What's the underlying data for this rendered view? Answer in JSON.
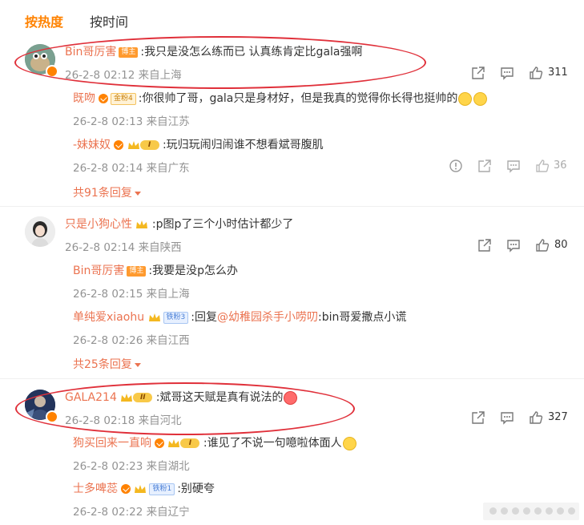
{
  "tabs": {
    "hot": "按热度",
    "time": "按时间"
  },
  "comments": [
    {
      "name": "Bin哥厉害",
      "badge": "博主",
      "text": ":我只是没怎么练而已 认真练肯定比gala强啊",
      "date": "26-2-8 02:12",
      "location": "来自上海",
      "likes": "311",
      "replies": [
        {
          "name": "既吻",
          "badge": "金粉4",
          "text": ":你很帅了哥，gala只是身材好，但是我真的觉得你长得也挺帅的",
          "date": "26-2-8 02:13",
          "location": "来自江苏"
        },
        {
          "name": "-妹妹奴",
          "level": "I",
          "text": ":玩归玩闹归闹谁不想看斌哥腹肌",
          "date": "26-2-8 02:14",
          "location": "来自广东",
          "likes": "36"
        }
      ],
      "more": "共91条回复"
    },
    {
      "name": "只是小狗心性",
      "text": ":p图p了三个小时估计都少了",
      "date": "26-2-8 02:14",
      "location": "来自陕西",
      "likes": "80",
      "replies": [
        {
          "name": "Bin哥厉害",
          "badge": "博主",
          "text": ":我要是没p怎么办",
          "date": "26-2-8 02:15",
          "location": "来自上海"
        },
        {
          "name": "单纯爱xiaohu",
          "badge": "铁粉3",
          "text_prefix": ":回复",
          "mention": "@幼稚园杀手小唠叨",
          "text": ":bin哥爱撒点小谎",
          "date": "26-2-8 02:26",
          "location": "来自江西"
        }
      ],
      "more": "共25条回复"
    },
    {
      "name": "GALA214",
      "level": "II",
      "text": ":斌哥这天赋是真有说法的",
      "date": "26-2-8 02:18",
      "location": "来自河北",
      "likes": "327",
      "replies": [
        {
          "name": "狗买回来一直响",
          "level": "I",
          "text": ":谁见了不说一句噫啦体面人",
          "date": "26-2-8 02:23",
          "location": "来自湖北"
        },
        {
          "name": "士多啤蕊",
          "badge": "铁粉1",
          "text": ":别硬夸",
          "date": "26-2-8 02:22",
          "location": "来自辽宁"
        }
      ]
    }
  ],
  "icons": [
    "share-icon",
    "comment-icon",
    "like-icon",
    "report-icon"
  ],
  "colors": {
    "accent": "#ff8200",
    "username": "#eb7350",
    "annotation": "#e0303a"
  }
}
